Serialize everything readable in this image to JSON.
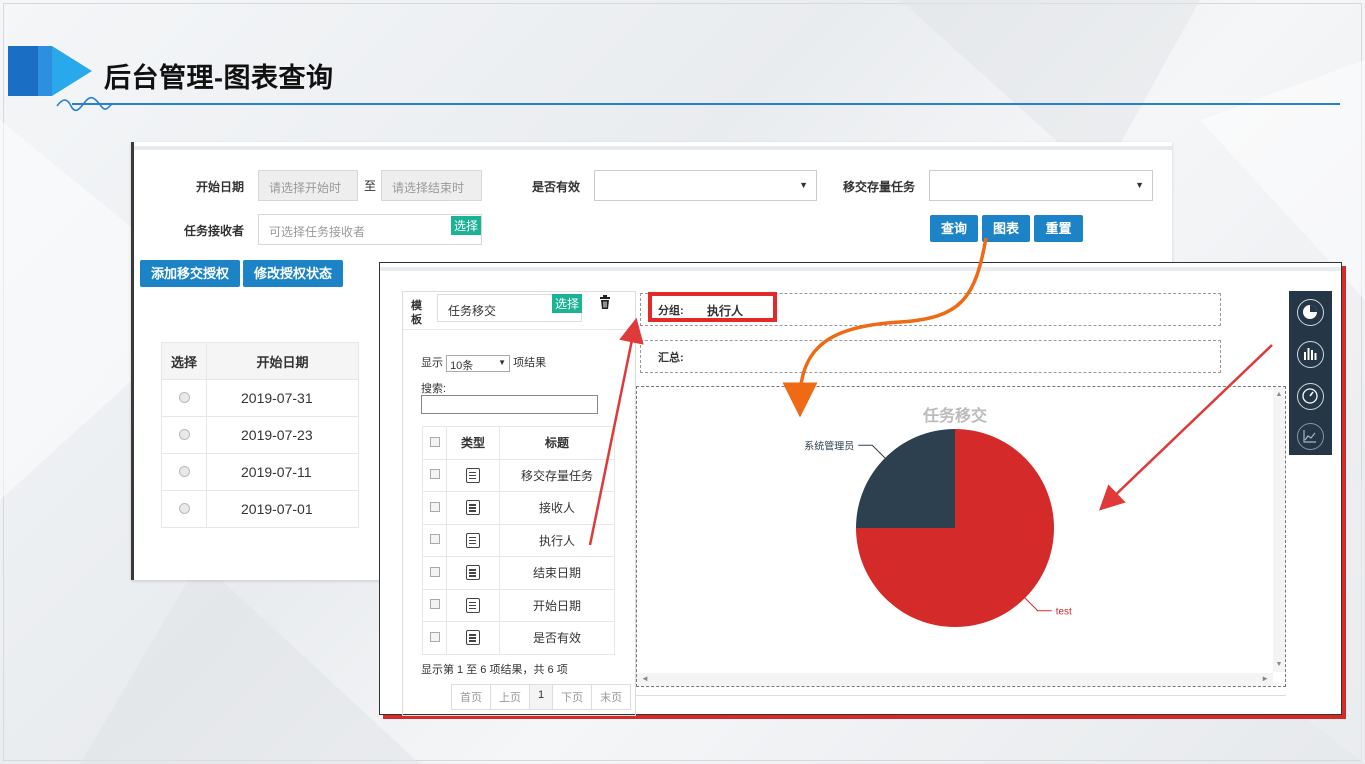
{
  "header": {
    "title": "后台管理-图表查询"
  },
  "filter": {
    "start_date_label": "开始日期",
    "start_placeholder": "请选择开始时",
    "to": "至",
    "end_placeholder": "请选择结束时",
    "valid_label": "是否有效",
    "transfer_label": "移交存量任务",
    "receiver_label": "任务接收者",
    "receiver_placeholder": "可选择任务接收者",
    "select_btn": "选择",
    "query_btn": "查询",
    "chart_btn": "图表",
    "reset_btn": "重置"
  },
  "actions": {
    "add": "添加移交授权",
    "modify": "修改授权状态"
  },
  "back_table": {
    "headers": [
      "选择",
      "开始日期"
    ],
    "rows": [
      "2019-07-31",
      "2019-07-23",
      "2019-07-11",
      "2019-07-01"
    ]
  },
  "template": {
    "label": "模板",
    "value": "任务移交",
    "select_btn": "选择"
  },
  "list": {
    "show_prefix": "显示",
    "page_size": "10条",
    "show_suffix": "项结果",
    "search_label": "搜索:",
    "headers": [
      "类型",
      "标题"
    ],
    "rows": [
      "移交存量任务",
      "接收人",
      "执行人",
      "结束日期",
      "开始日期",
      "是否有效"
    ],
    "summary": "显示第 1 至 6 项结果，共 6 项",
    "pager": [
      "首页",
      "上页",
      "1",
      "下页",
      "末页"
    ]
  },
  "group": {
    "label": "分组:",
    "value": "执行人"
  },
  "total": {
    "label": "汇总:"
  },
  "colors": {
    "accent": "#1c84c6",
    "teal": "#1ab394",
    "red": "#d42a2a",
    "dark": "#2c4050",
    "orange": "#ef6a14"
  },
  "chart_data": {
    "type": "pie",
    "title": "任务移交",
    "series": [
      {
        "name": "test",
        "value": 75,
        "color": "#d42a2a"
      },
      {
        "name": "系统管理员",
        "value": 25,
        "color": "#2c4050"
      }
    ]
  }
}
